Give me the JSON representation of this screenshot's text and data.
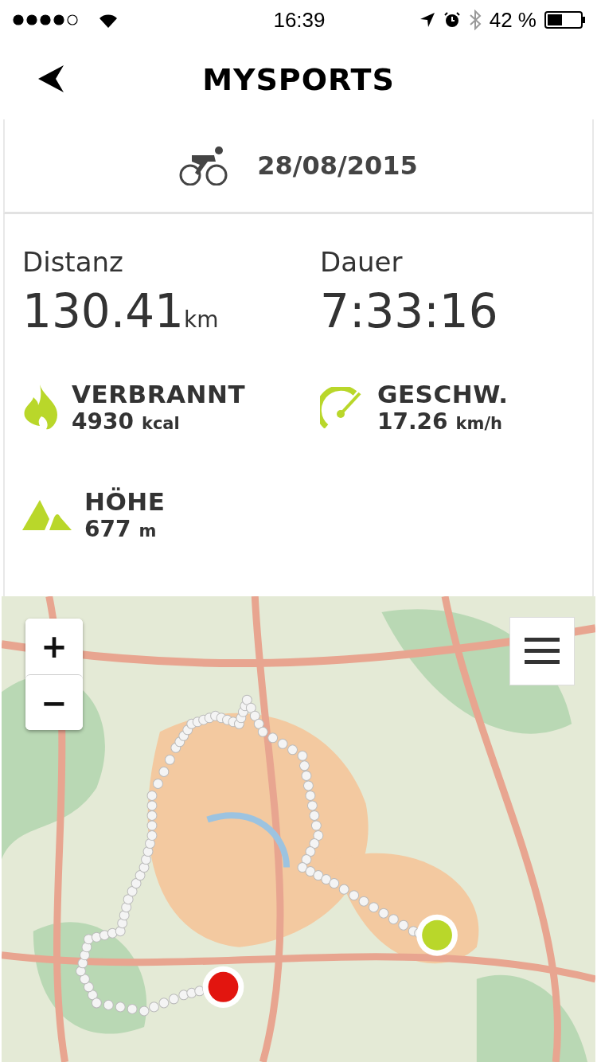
{
  "status_bar": {
    "time": "16:39",
    "battery": "42 %"
  },
  "header": {
    "title": "MYSPORTS"
  },
  "activity": {
    "date": "28/08/2015"
  },
  "main_stats": [
    {
      "label": "Distanz",
      "value": "130.41",
      "unit": "km"
    },
    {
      "label": "Dauer",
      "value": "7:33:16"
    }
  ],
  "stats": [
    {
      "kind": "flame",
      "label": "VERBRANNT",
      "value": "4930",
      "unit": "kcal"
    },
    {
      "kind": "gauge",
      "label": "GESCHW.",
      "value": "17.26",
      "unit": "km/h"
    },
    {
      "kind": "mountain",
      "label": "HÖHE",
      "value": "677",
      "unit": "m"
    }
  ],
  "map": {
    "zoom_in": "+",
    "zoom_out": "−"
  }
}
